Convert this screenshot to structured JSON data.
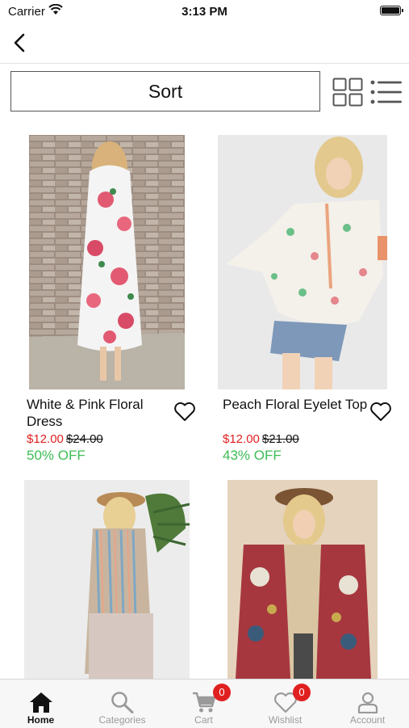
{
  "status_bar": {
    "carrier": "Carrier",
    "time": "3:13 PM"
  },
  "toolbar": {
    "sort_label": "Sort"
  },
  "products": [
    {
      "name": "White & Pink Floral Dress",
      "sale_price": "$12.00",
      "original_price": "$24.00",
      "discount": "50% OFF"
    },
    {
      "name": "Peach Floral Eyelet Top",
      "sale_price": "$12.00",
      "original_price": "$21.00",
      "discount": "43% OFF"
    },
    {
      "name": "",
      "sale_price": "",
      "original_price": "",
      "discount": ""
    },
    {
      "name": "",
      "sale_price": "",
      "original_price": "",
      "discount": ""
    }
  ],
  "tab_bar": {
    "home": "Home",
    "categories": "Categories",
    "cart": "Cart",
    "cart_count": "0",
    "wishlist": "Wishlist",
    "wishlist_count": "0",
    "account": "Account"
  },
  "colors": {
    "sale": "#e02020",
    "discount": "#3dbd55",
    "badge": "#e02020"
  }
}
